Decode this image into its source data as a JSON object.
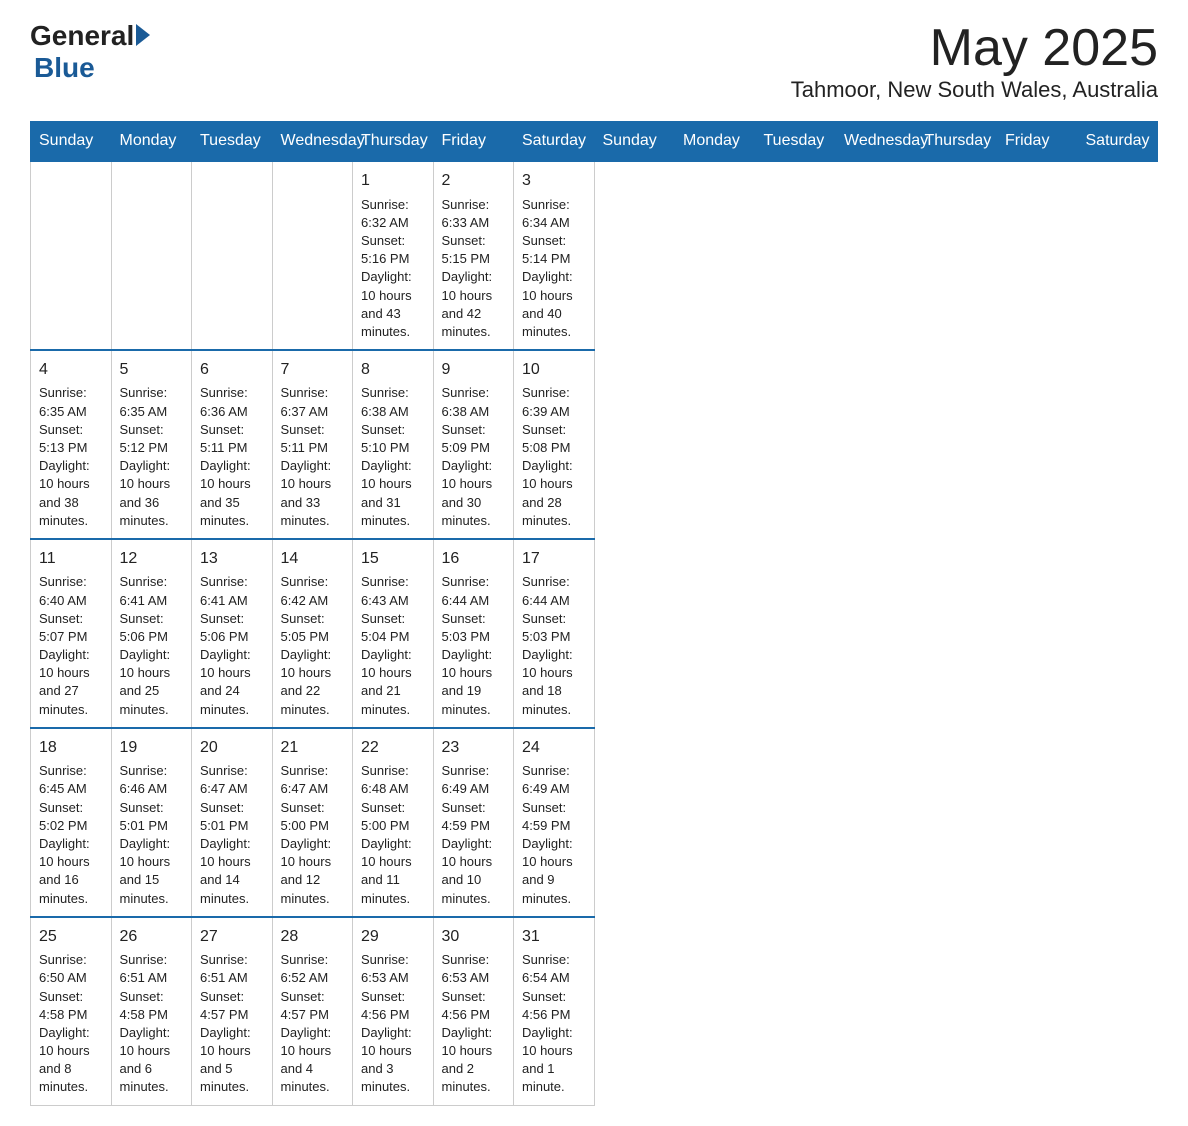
{
  "header": {
    "logo_general": "General",
    "logo_blue": "Blue",
    "month_title": "May 2025",
    "location": "Tahmoor, New South Wales, Australia"
  },
  "days_of_week": [
    "Sunday",
    "Monday",
    "Tuesday",
    "Wednesday",
    "Thursday",
    "Friday",
    "Saturday"
  ],
  "weeks": [
    [
      {
        "day": "",
        "info": ""
      },
      {
        "day": "",
        "info": ""
      },
      {
        "day": "",
        "info": ""
      },
      {
        "day": "",
        "info": ""
      },
      {
        "day": "1",
        "info": "Sunrise: 6:32 AM\nSunset: 5:16 PM\nDaylight: 10 hours and 43 minutes."
      },
      {
        "day": "2",
        "info": "Sunrise: 6:33 AM\nSunset: 5:15 PM\nDaylight: 10 hours and 42 minutes."
      },
      {
        "day": "3",
        "info": "Sunrise: 6:34 AM\nSunset: 5:14 PM\nDaylight: 10 hours and 40 minutes."
      }
    ],
    [
      {
        "day": "4",
        "info": "Sunrise: 6:35 AM\nSunset: 5:13 PM\nDaylight: 10 hours and 38 minutes."
      },
      {
        "day": "5",
        "info": "Sunrise: 6:35 AM\nSunset: 5:12 PM\nDaylight: 10 hours and 36 minutes."
      },
      {
        "day": "6",
        "info": "Sunrise: 6:36 AM\nSunset: 5:11 PM\nDaylight: 10 hours and 35 minutes."
      },
      {
        "day": "7",
        "info": "Sunrise: 6:37 AM\nSunset: 5:11 PM\nDaylight: 10 hours and 33 minutes."
      },
      {
        "day": "8",
        "info": "Sunrise: 6:38 AM\nSunset: 5:10 PM\nDaylight: 10 hours and 31 minutes."
      },
      {
        "day": "9",
        "info": "Sunrise: 6:38 AM\nSunset: 5:09 PM\nDaylight: 10 hours and 30 minutes."
      },
      {
        "day": "10",
        "info": "Sunrise: 6:39 AM\nSunset: 5:08 PM\nDaylight: 10 hours and 28 minutes."
      }
    ],
    [
      {
        "day": "11",
        "info": "Sunrise: 6:40 AM\nSunset: 5:07 PM\nDaylight: 10 hours and 27 minutes."
      },
      {
        "day": "12",
        "info": "Sunrise: 6:41 AM\nSunset: 5:06 PM\nDaylight: 10 hours and 25 minutes."
      },
      {
        "day": "13",
        "info": "Sunrise: 6:41 AM\nSunset: 5:06 PM\nDaylight: 10 hours and 24 minutes."
      },
      {
        "day": "14",
        "info": "Sunrise: 6:42 AM\nSunset: 5:05 PM\nDaylight: 10 hours and 22 minutes."
      },
      {
        "day": "15",
        "info": "Sunrise: 6:43 AM\nSunset: 5:04 PM\nDaylight: 10 hours and 21 minutes."
      },
      {
        "day": "16",
        "info": "Sunrise: 6:44 AM\nSunset: 5:03 PM\nDaylight: 10 hours and 19 minutes."
      },
      {
        "day": "17",
        "info": "Sunrise: 6:44 AM\nSunset: 5:03 PM\nDaylight: 10 hours and 18 minutes."
      }
    ],
    [
      {
        "day": "18",
        "info": "Sunrise: 6:45 AM\nSunset: 5:02 PM\nDaylight: 10 hours and 16 minutes."
      },
      {
        "day": "19",
        "info": "Sunrise: 6:46 AM\nSunset: 5:01 PM\nDaylight: 10 hours and 15 minutes."
      },
      {
        "day": "20",
        "info": "Sunrise: 6:47 AM\nSunset: 5:01 PM\nDaylight: 10 hours and 14 minutes."
      },
      {
        "day": "21",
        "info": "Sunrise: 6:47 AM\nSunset: 5:00 PM\nDaylight: 10 hours and 12 minutes."
      },
      {
        "day": "22",
        "info": "Sunrise: 6:48 AM\nSunset: 5:00 PM\nDaylight: 10 hours and 11 minutes."
      },
      {
        "day": "23",
        "info": "Sunrise: 6:49 AM\nSunset: 4:59 PM\nDaylight: 10 hours and 10 minutes."
      },
      {
        "day": "24",
        "info": "Sunrise: 6:49 AM\nSunset: 4:59 PM\nDaylight: 10 hours and 9 minutes."
      }
    ],
    [
      {
        "day": "25",
        "info": "Sunrise: 6:50 AM\nSunset: 4:58 PM\nDaylight: 10 hours and 8 minutes."
      },
      {
        "day": "26",
        "info": "Sunrise: 6:51 AM\nSunset: 4:58 PM\nDaylight: 10 hours and 6 minutes."
      },
      {
        "day": "27",
        "info": "Sunrise: 6:51 AM\nSunset: 4:57 PM\nDaylight: 10 hours and 5 minutes."
      },
      {
        "day": "28",
        "info": "Sunrise: 6:52 AM\nSunset: 4:57 PM\nDaylight: 10 hours and 4 minutes."
      },
      {
        "day": "29",
        "info": "Sunrise: 6:53 AM\nSunset: 4:56 PM\nDaylight: 10 hours and 3 minutes."
      },
      {
        "day": "30",
        "info": "Sunrise: 6:53 AM\nSunset: 4:56 PM\nDaylight: 10 hours and 2 minutes."
      },
      {
        "day": "31",
        "info": "Sunrise: 6:54 AM\nSunset: 4:56 PM\nDaylight: 10 hours and 1 minute."
      }
    ]
  ]
}
